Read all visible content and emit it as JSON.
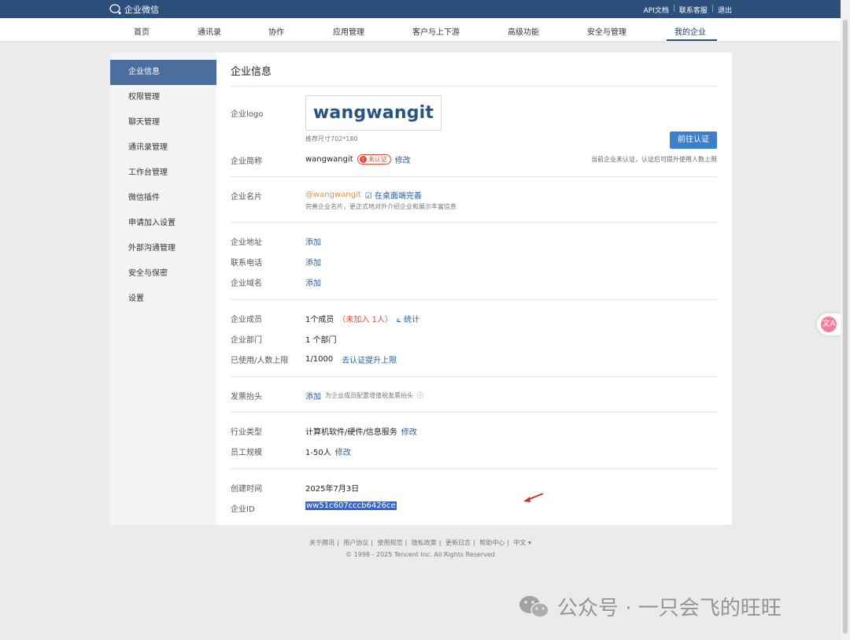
{
  "topbar": {
    "brand": "企业微信",
    "links": [
      "API文档",
      "联系客服",
      "退出"
    ]
  },
  "nav": {
    "items": [
      "首页",
      "通讯录",
      "协作",
      "应用管理",
      "客户与上下游",
      "高级功能",
      "安全与管理",
      "我的企业"
    ],
    "active": "我的企业"
  },
  "sidebar": {
    "items": [
      "企业信息",
      "权限管理",
      "聊天管理",
      "通讯录管理",
      "工作台管理",
      "微信插件",
      "申请加入设置",
      "外部沟通管理",
      "安全与保密",
      "设置"
    ],
    "active": "企业信息"
  },
  "main": {
    "title": "企业信息",
    "logo": {
      "label": "企业logo",
      "text": "wangwangit",
      "hint": "推荐尺寸702*180"
    },
    "verify_button": "前往认证",
    "short_name": {
      "label": "企业简称",
      "value": "wangwangit",
      "badge": "未认证",
      "action": "修改",
      "note": "当前企业未认证，认证后可提升使用人数上限"
    },
    "card": {
      "label": "企业名片",
      "handle": "@wangwangit",
      "action": "在桌面端完善",
      "hint": "完善企业名片，更正式地对外介绍企业和展示丰富信息"
    },
    "address": {
      "label": "企业地址",
      "action": "添加"
    },
    "phone": {
      "label": "联系电话",
      "action": "添加"
    },
    "domain": {
      "label": "企业域名",
      "action": "添加"
    },
    "members": {
      "label": "企业成员",
      "value": "1个成员",
      "pending": "（未加入 1人）",
      "action": "统计"
    },
    "departments": {
      "label": "企业部门",
      "value": "1 个部门"
    },
    "limit": {
      "label": "已使用/人数上限",
      "value": "1/1000",
      "action": "去认证提升上限"
    },
    "invoice": {
      "label": "发票抬头",
      "action": "添加",
      "hint": "为企业成员配置增值税发票抬头"
    },
    "industry": {
      "label": "行业类型",
      "value": "计算机软件/硬件/信息服务",
      "action": "修改"
    },
    "staff": {
      "label": "员工规模",
      "value": "1-50人",
      "action": "修改"
    },
    "created": {
      "label": "创建时间",
      "value": "2025年7月3日"
    },
    "corp_id": {
      "label": "企业ID",
      "value": "ww51c607cccb6426ce"
    }
  },
  "footer": {
    "links": [
      "关于腾讯",
      "用户协议",
      "使用规范",
      "隐私政策",
      "更新日志",
      "帮助中心",
      "中文 ▾"
    ],
    "copyright": "© 1998 - 2025 Tencent Inc. All Rights Reserved"
  },
  "float_button": {
    "glyph": "文A"
  },
  "watermark": {
    "text": "公众号 · 一只会飞的旺旺"
  },
  "colors": {
    "topbar": "#2d4f7c",
    "sidebar_active": "#4a6f9f",
    "link": "#2a5d9b",
    "verify_button": "#3d7fc9",
    "alert": "#e14b3b",
    "selection": "#3367d6"
  }
}
